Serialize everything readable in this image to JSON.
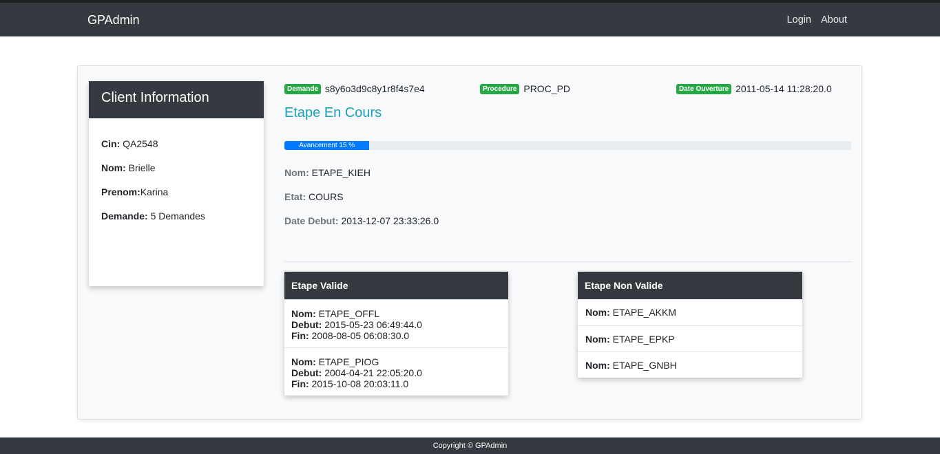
{
  "navbar": {
    "brand": "GPAdmin",
    "links": [
      "Login",
      "About"
    ]
  },
  "client": {
    "title": "Client Information",
    "rows": [
      {
        "label": "Cin:",
        "value": " QA2548"
      },
      {
        "label": "Nom:",
        "value": " Brielle"
      },
      {
        "label": "Prenom:",
        "value": "Karina"
      },
      {
        "label": "Demande:",
        "value": " 5 Demandes"
      }
    ]
  },
  "meta": {
    "demande": {
      "badge": "Demande",
      "value": "s8y6o3d9c8y1r8f4s7e4"
    },
    "procedure": {
      "badge": "Procedure",
      "value": "PROC_PD"
    },
    "date_ouverture": {
      "badge": "Date Ouverture",
      "value": "2011-05-14 11:28:20.0"
    }
  },
  "etape": {
    "title": "Etape En Cours",
    "progress_label": "Avancement 15 %",
    "progress_value": 15,
    "nom_label": "Nom:",
    "nom": "ETAPE_KIEH",
    "etat_label": "Etat:",
    "etat": "COURS",
    "date_debut_label": "Date Debut:",
    "date_debut": "2013-12-07 23:33:26.0"
  },
  "valid": {
    "title": "Etape Valide",
    "labels": {
      "nom": "Nom:",
      "debut": "Debut:",
      "fin": "Fin:"
    },
    "items": [
      {
        "nom": "ETAPE_OFFL",
        "debut": "2015-05-23 06:49:44.0",
        "fin": "2008-08-05 06:08:30.0"
      },
      {
        "nom": "ETAPE_PIOG",
        "debut": "2004-04-21 22:05:20.0",
        "fin": "2015-10-08 20:03:11.0"
      }
    ]
  },
  "nonvalid": {
    "title": "Etape Non Valide",
    "label": "Nom:",
    "items": [
      "ETAPE_AKKM",
      "ETAPE_EPKP",
      "ETAPE_GNBH"
    ]
  },
  "footer": {
    "text": "Copyright © GPAdmin"
  }
}
